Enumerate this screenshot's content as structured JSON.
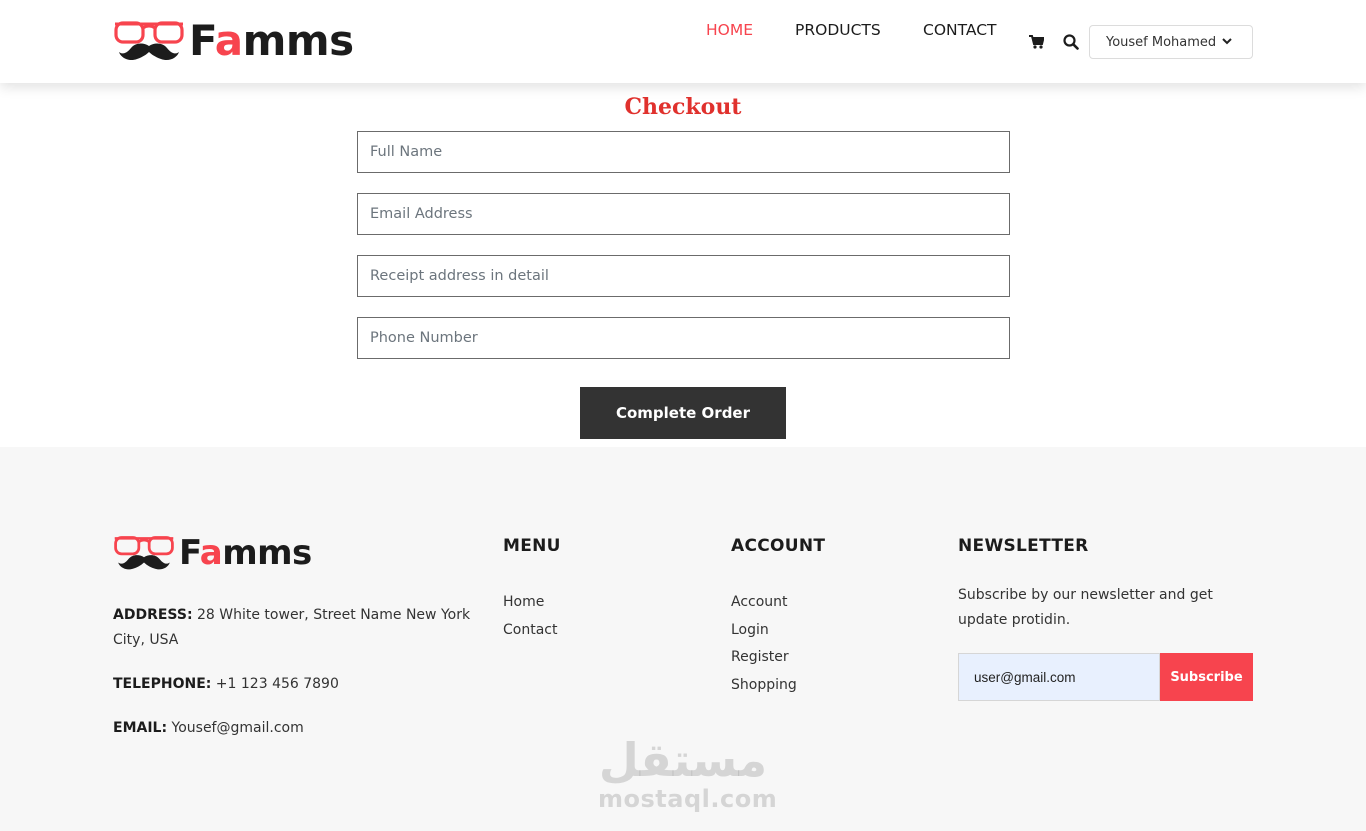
{
  "header": {
    "logo": {
      "text_before": "F",
      "text_accent": "a",
      "text_after": "mms"
    },
    "nav": {
      "home": "HOME",
      "products": "PRODUCTS",
      "contact": "CONTACT"
    },
    "user_menu": "Yousef Mohamed",
    "icons": [
      "cart-icon",
      "search-icon",
      "chevron-down-icon"
    ]
  },
  "checkout": {
    "title": "Checkout",
    "fields": {
      "full_name": "Full Name",
      "email": "Email Address",
      "address": "Receipt address in detail",
      "phone": "Phone Number"
    },
    "submit_label": "Complete Order"
  },
  "footer": {
    "logo": {
      "text_before": "F",
      "text_accent": "a",
      "text_after": "mms"
    },
    "address_label": "ADDRESS:",
    "address_value": " 28 White tower, Street Name New York City, USA",
    "telephone_label": "TELEPHONE:",
    "telephone_value": " +1 123 456 7890",
    "email_label": "EMAIL:",
    "email_value": " Yousef@gmail.com",
    "menu": {
      "title": "MENU",
      "items": [
        "Home",
        "Contact"
      ]
    },
    "account": {
      "title": "ACCOUNT",
      "items": [
        "Account",
        "Login",
        "Register",
        "Shopping"
      ]
    },
    "newsletter": {
      "title": "NEWSLETTER",
      "text": "Subscribe by our newsletter and get update protidin.",
      "input_value": "user@gmail.com",
      "button_label": "Subscribe"
    },
    "watermark": {
      "arabic": "مستقل",
      "latin": "mostaql.com"
    }
  },
  "colors": {
    "accent": "#f7444e",
    "title_red": "#e0312d",
    "button_dark": "#333333",
    "footer_bg": "#f7f7f7",
    "autofill_bg": "#e8f0fe"
  }
}
